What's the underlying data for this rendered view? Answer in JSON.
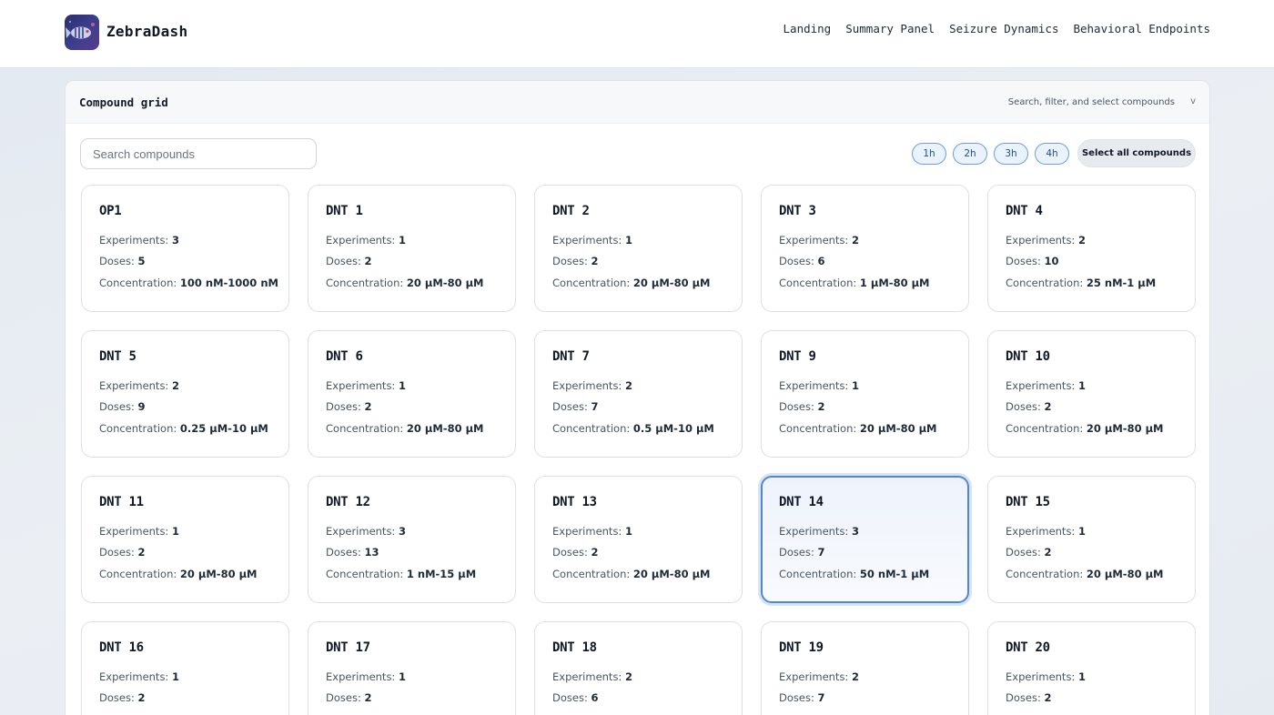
{
  "app": {
    "name": "ZebraDash",
    "logo_icon": "zebrafish-logo-icon"
  },
  "nav": [
    {
      "label": "Landing"
    },
    {
      "label": "Summary Panel"
    },
    {
      "label": "Seizure Dynamics"
    },
    {
      "label": "Behavioral Endpoints"
    }
  ],
  "panel": {
    "title": "Compound grid",
    "hint": "Search, filter, and select compounds",
    "chevron": "v"
  },
  "search": {
    "placeholder": "Search compounds",
    "value": ""
  },
  "time_filters": [
    {
      "label": "1h"
    },
    {
      "label": "2h"
    },
    {
      "label": "3h"
    },
    {
      "label": "4h"
    }
  ],
  "select_all_label": "Select all compounds",
  "labels": {
    "experiments": "Experiments:",
    "doses": "Doses:",
    "concentration": "Concentration:"
  },
  "colors": {
    "accent": "#4f86d6",
    "pill_border": "#6b9fd8",
    "pill_bg": "#eaf2fc"
  },
  "selected_compound": "DNT 14",
  "compounds": [
    {
      "name": "OP1",
      "experiments": "3",
      "doses": "5",
      "concentration": "100 nM-1000 nM"
    },
    {
      "name": "DNT 1",
      "experiments": "1",
      "doses": "2",
      "concentration": "20 µM-80 µM"
    },
    {
      "name": "DNT 2",
      "experiments": "1",
      "doses": "2",
      "concentration": "20 µM-80 µM"
    },
    {
      "name": "DNT 3",
      "experiments": "2",
      "doses": "6",
      "concentration": "1 µM-80 µM"
    },
    {
      "name": "DNT 4",
      "experiments": "2",
      "doses": "10",
      "concentration": "25 nM-1 µM"
    },
    {
      "name": "DNT 5",
      "experiments": "2",
      "doses": "9",
      "concentration": "0.25 µM-10 µM"
    },
    {
      "name": "DNT 6",
      "experiments": "1",
      "doses": "2",
      "concentration": "20 µM-80 µM"
    },
    {
      "name": "DNT 7",
      "experiments": "2",
      "doses": "7",
      "concentration": "0.5 µM-10 µM"
    },
    {
      "name": "DNT 9",
      "experiments": "1",
      "doses": "2",
      "concentration": "20 µM-80 µM"
    },
    {
      "name": "DNT 10",
      "experiments": "1",
      "doses": "2",
      "concentration": "20 µM-80 µM"
    },
    {
      "name": "DNT 11",
      "experiments": "1",
      "doses": "2",
      "concentration": "20 µM-80 µM"
    },
    {
      "name": "DNT 12",
      "experiments": "3",
      "doses": "13",
      "concentration": "1 nM-15 µM"
    },
    {
      "name": "DNT 13",
      "experiments": "1",
      "doses": "2",
      "concentration": "20 µM-80 µM"
    },
    {
      "name": "DNT 14",
      "experiments": "3",
      "doses": "7",
      "concentration": "50 nM-1 µM"
    },
    {
      "name": "DNT 15",
      "experiments": "1",
      "doses": "2",
      "concentration": "20 µM-80 µM"
    },
    {
      "name": "DNT 16",
      "experiments": "1",
      "doses": "2",
      "concentration": null
    },
    {
      "name": "DNT 17",
      "experiments": "1",
      "doses": "2",
      "concentration": null
    },
    {
      "name": "DNT 18",
      "experiments": "2",
      "doses": "6",
      "concentration": null
    },
    {
      "name": "DNT 19",
      "experiments": "2",
      "doses": "7",
      "concentration": null
    },
    {
      "name": "DNT 20",
      "experiments": "1",
      "doses": "2",
      "concentration": null
    }
  ]
}
